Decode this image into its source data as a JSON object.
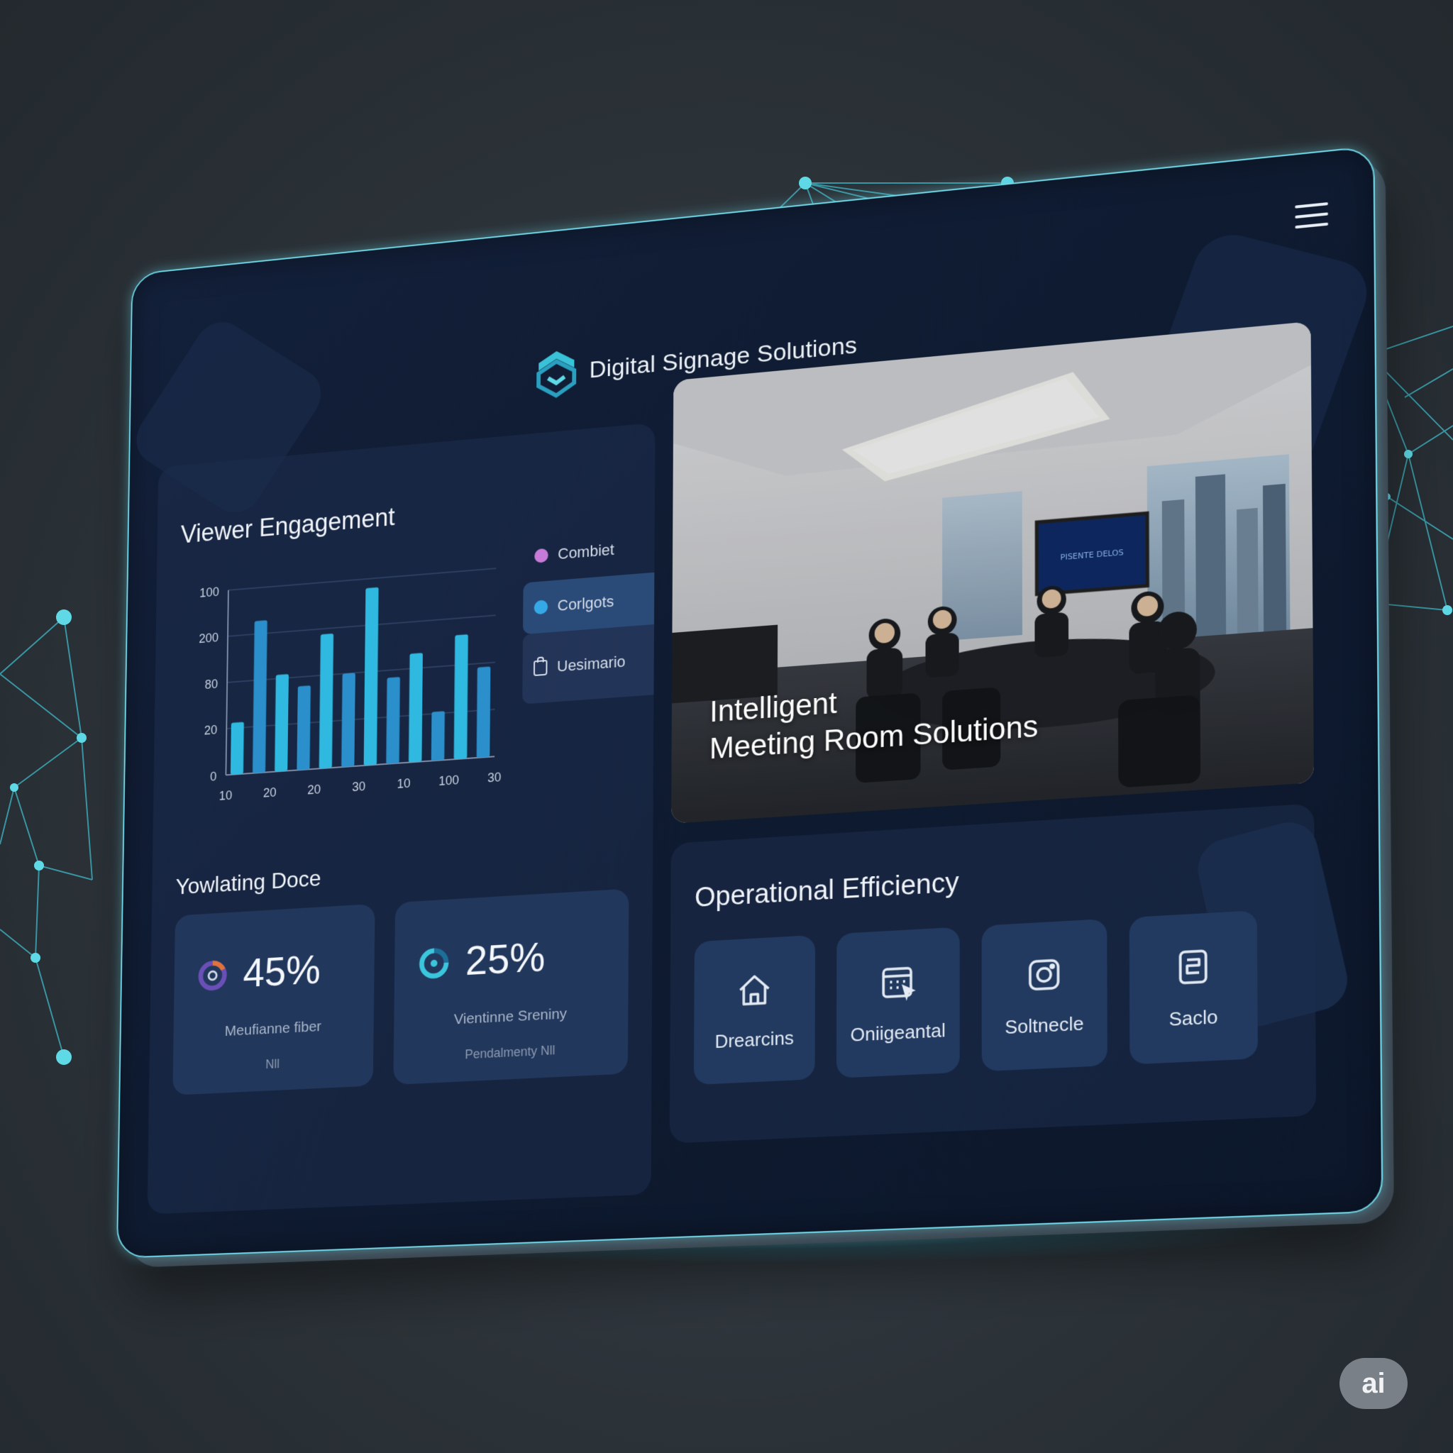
{
  "app": {
    "title": "Digital Signage Solutions"
  },
  "engagement": {
    "title": "Viewer Engagement",
    "legend": [
      {
        "label": "Combiet",
        "color": "#c77bd8"
      },
      {
        "label": "Corlgots",
        "color": "#35a9e6"
      },
      {
        "label": "Uesimario",
        "color": "#d6deea"
      }
    ]
  },
  "chart_data": {
    "type": "bar",
    "y_tick_labels": [
      "0",
      "20",
      "80",
      "200",
      "100"
    ],
    "x_tick_labels": [
      "10",
      "20",
      "20",
      "30",
      "10",
      "100",
      "30"
    ],
    "values": [
      28,
      82,
      52,
      45,
      72,
      50,
      95,
      46,
      58,
      26,
      66,
      48
    ],
    "ylim": [
      0,
      100
    ],
    "grid": true,
    "bar_color": "#2fb9e0"
  },
  "yd": {
    "title": "Yowlating Doce",
    "cards": [
      {
        "value": "45%",
        "label": "Meufianne fiber",
        "sub": "Nll"
      },
      {
        "value": "25%",
        "label": "Vientinne Sreniny",
        "sub": "Pendalmenty Nll"
      }
    ]
  },
  "hero": {
    "caption_line1": "Intelligent",
    "caption_line2": "Meeting Room Solutions",
    "screen_text": "PISENTE DELOS"
  },
  "ops": {
    "title": "Operational Efficiency",
    "tiles": [
      {
        "label": "Drearcins",
        "icon": "home-icon"
      },
      {
        "label": "Oniigeantal",
        "icon": "calendar-grid-icon"
      },
      {
        "label": "Soltnecle",
        "icon": "camera-icon"
      },
      {
        "label": "Saclo",
        "icon": "document-icon"
      }
    ]
  },
  "badge": {
    "label": "ai"
  },
  "colors": {
    "accent": "#6fd6e6",
    "bar": "#2fb9e0",
    "panel": "#13203a"
  }
}
